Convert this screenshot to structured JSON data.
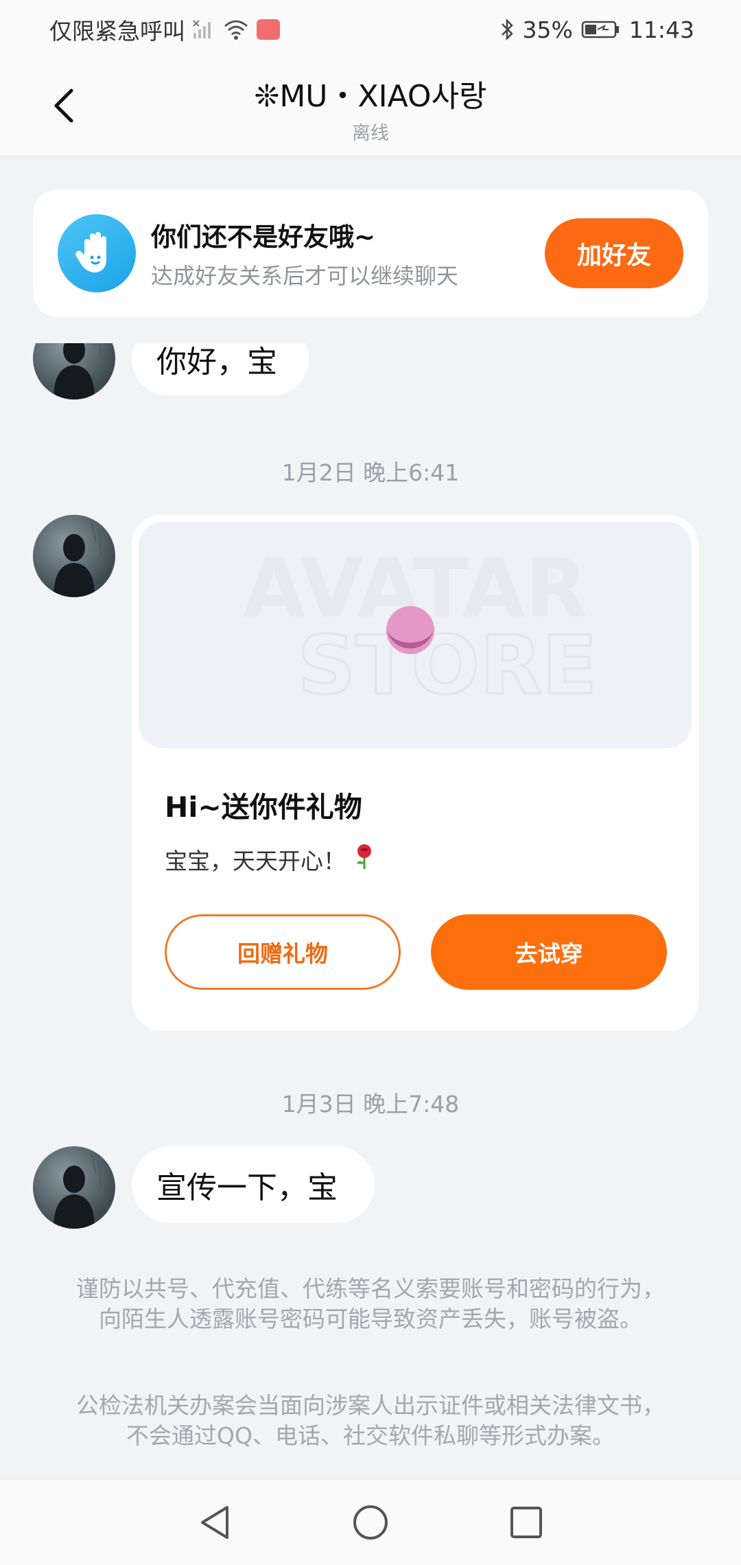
{
  "status_bar": {
    "carrier_text": "仅限紧急呼叫",
    "battery": "35%",
    "time": "11:43",
    "icons": [
      "signal-icon",
      "wifi-icon",
      "app-badge-icon",
      "bluetooth-icon",
      "battery-icon"
    ]
  },
  "header": {
    "title": "❊MU・XIAO사랑",
    "status": "离线",
    "back_icon": "chevron-left-icon"
  },
  "friend_banner": {
    "title": "你们还不是好友哦~",
    "subtitle": "达成好友关系后才可以继续聊天",
    "button": "加好友"
  },
  "messages": [
    {
      "type": "text",
      "text": "你好，宝"
    },
    {
      "type": "timestamp",
      "text": "1月2日 晚上6:41"
    },
    {
      "type": "gift",
      "watermark_line1": "AVATAR",
      "watermark_line2": "STORE",
      "title": "Hi~送你件礼物",
      "message": "宝宝，天天开心！",
      "gift_icon": "rose-icon",
      "button_return": "回赠礼物",
      "button_try": "去试穿"
    },
    {
      "type": "timestamp",
      "text": "1月3日 晚上7:48"
    },
    {
      "type": "text",
      "text": "宣传一下，宝"
    }
  ],
  "notices": [
    "谨防以共号、代充值、代练等名义索要账号和密码的行为，向陌生人透露账号密码可能导致资产丢失，账号被盗。",
    "公检法机关办案会当面向涉案人出示证件或相关法律文书，不会通过QQ、电话、社交软件私聊等形式办案。"
  ],
  "colors": {
    "accent": "#fc6a14",
    "background": "#f1f3f5",
    "hand_icon": "#1aa2e8"
  },
  "nav": [
    "back-triangle-icon",
    "home-circle-icon",
    "recents-square-icon"
  ]
}
